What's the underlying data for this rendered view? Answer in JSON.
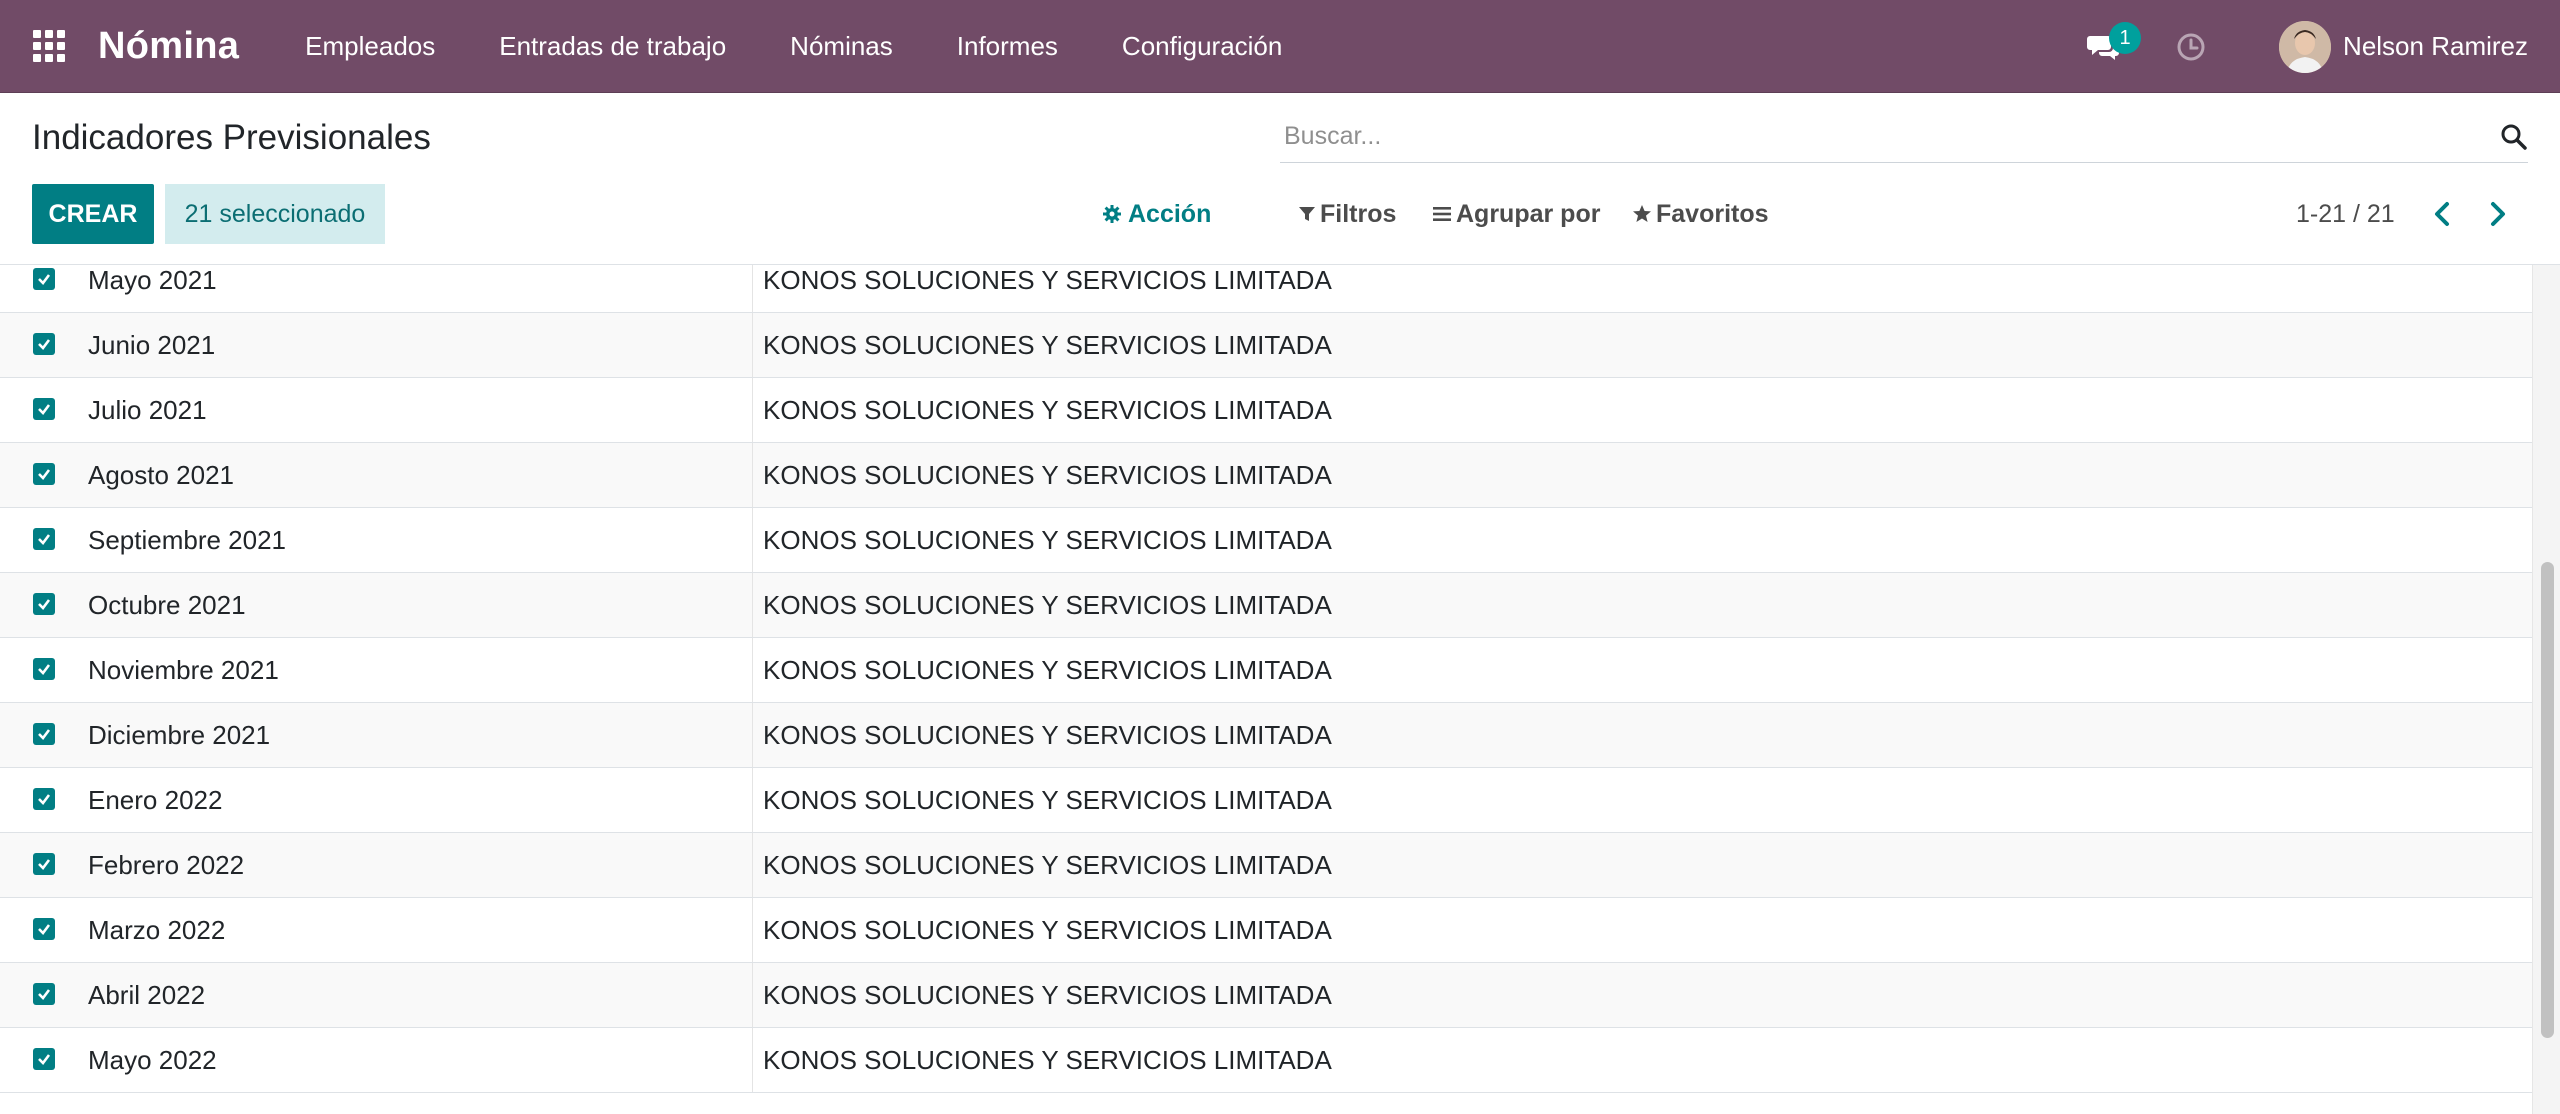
{
  "navbar": {
    "brand": "Nómina",
    "menu": [
      "Empleados",
      "Entradas de trabajo",
      "Nóminas",
      "Informes",
      "Configuración"
    ],
    "chat_count": "1",
    "user_name": "Nelson Ramirez",
    "icons": {
      "apps": "apps-grid-icon",
      "chat": "comments-icon",
      "activity": "clock-icon"
    }
  },
  "control_panel": {
    "title": "Indicadores Previsionales",
    "search_placeholder": "Buscar...",
    "create_label": "CREAR",
    "selected_label": "21 seleccionado",
    "action_label": "Acción",
    "filters_label": "Filtros",
    "group_by_label": "Agrupar por",
    "favorites_label": "Favoritos",
    "pager_text": "1-21 / 21"
  },
  "list": {
    "rows": [
      {
        "name": "Mayo 2021",
        "company": "KONOS SOLUCIONES Y SERVICIOS LIMITADA",
        "checked": true
      },
      {
        "name": "Junio 2021",
        "company": "KONOS SOLUCIONES Y SERVICIOS LIMITADA",
        "checked": true
      },
      {
        "name": "Julio 2021",
        "company": "KONOS SOLUCIONES Y SERVICIOS LIMITADA",
        "checked": true
      },
      {
        "name": "Agosto 2021",
        "company": "KONOS SOLUCIONES Y SERVICIOS LIMITADA",
        "checked": true
      },
      {
        "name": "Septiembre 2021",
        "company": "KONOS SOLUCIONES Y SERVICIOS LIMITADA",
        "checked": true
      },
      {
        "name": "Octubre 2021",
        "company": "KONOS SOLUCIONES Y SERVICIOS LIMITADA",
        "checked": true
      },
      {
        "name": "Noviembre 2021",
        "company": "KONOS SOLUCIONES Y SERVICIOS LIMITADA",
        "checked": true
      },
      {
        "name": "Diciembre 2021",
        "company": "KONOS SOLUCIONES Y SERVICIOS LIMITADA",
        "checked": true
      },
      {
        "name": "Enero 2022",
        "company": "KONOS SOLUCIONES Y SERVICIOS LIMITADA",
        "checked": true
      },
      {
        "name": "Febrero 2022",
        "company": "KONOS SOLUCIONES Y SERVICIOS LIMITADA",
        "checked": true
      },
      {
        "name": "Marzo 2022",
        "company": "KONOS SOLUCIONES Y SERVICIOS LIMITADA",
        "checked": true
      },
      {
        "name": "Abril 2022",
        "company": "KONOS SOLUCIONES Y SERVICIOS LIMITADA",
        "checked": true
      },
      {
        "name": "Mayo 2022",
        "company": "KONOS SOLUCIONES Y SERVICIOS LIMITADA",
        "checked": true
      }
    ]
  },
  "colors": {
    "navbar": "#714b67",
    "primary": "#017e84",
    "badge": "#00a09d",
    "selected_bg": "#d3ecee"
  }
}
